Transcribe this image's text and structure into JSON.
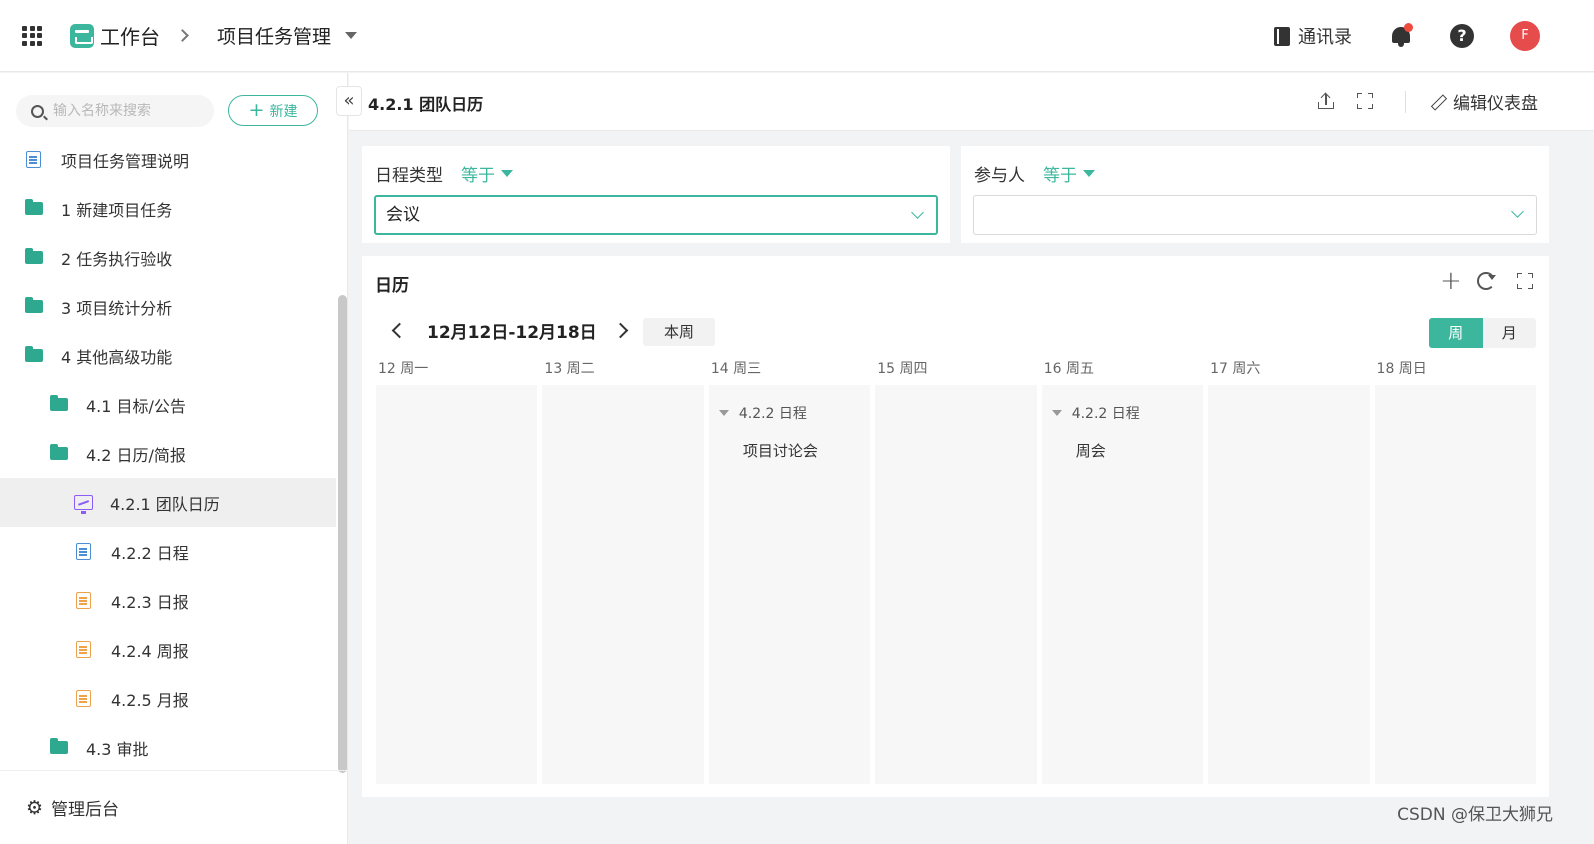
{
  "topbar": {
    "home": "工作台",
    "current": "项目任务管理",
    "contacts": "通讯录",
    "avatar_letter": "F",
    "icons": [
      "apps-grid-icon",
      "logo-icon",
      "chevron-right-icon",
      "caret-down-icon",
      "contacts-book-icon",
      "bell-icon",
      "help-icon"
    ]
  },
  "sidebar": {
    "search_placeholder": "输入名称来搜索",
    "new_label": "新建",
    "items": [
      {
        "label": "项目任务管理说明",
        "icon": "doc-icon"
      },
      {
        "label": "1 新建项目任务",
        "icon": "folder-icon"
      },
      {
        "label": "2 任务执行验收",
        "icon": "folder-icon"
      },
      {
        "label": "3 项目统计分析",
        "icon": "folder-icon"
      },
      {
        "label": "4 其他高级功能",
        "icon": "folder-icon"
      },
      {
        "label": "4.1 目标/公告",
        "icon": "folder-icon"
      },
      {
        "label": "4.2 日历/简报",
        "icon": "folder-icon"
      },
      {
        "label": "4.2.1 团队日历",
        "icon": "dashboard-icon",
        "active": true
      },
      {
        "label": "4.2.2 日程",
        "icon": "doc-icon"
      },
      {
        "label": "4.2.3 日报",
        "icon": "doc-icon-orange"
      },
      {
        "label": "4.2.4 周报",
        "icon": "doc-icon-orange"
      },
      {
        "label": "4.2.5 月报",
        "icon": "doc-icon-orange"
      },
      {
        "label": "4.3 审批",
        "icon": "folder-icon"
      }
    ],
    "admin_label": "管理后台",
    "collapse_glyph": "«"
  },
  "main": {
    "title": "4.2.1 团队日历",
    "edit_label": "编辑仪表盘"
  },
  "filters": [
    {
      "label": "日程类型",
      "operator": "等于",
      "value": "会议"
    },
    {
      "label": "参与人",
      "operator": "等于",
      "value": ""
    }
  ],
  "calendar": {
    "title": "日历",
    "range": "12月12日-12月18日",
    "today_label": "本周",
    "view_week": "周",
    "view_month": "月",
    "days": [
      {
        "label": "12 周一"
      },
      {
        "label": "13 周二"
      },
      {
        "label": "14 周三",
        "event": {
          "group": "4.2.2 日程",
          "title": "项目讨论会"
        }
      },
      {
        "label": "15 周四"
      },
      {
        "label": "16 周五",
        "event": {
          "group": "4.2.2 日程",
          "title": "周会"
        }
      },
      {
        "label": "17 周六"
      },
      {
        "label": "18 周日"
      }
    ]
  },
  "watermark": "CSDN @保卫大狮兄",
  "colors": {
    "accent": "#3cb79e",
    "badge": "#f04a3e",
    "avatar": "#e74c4c"
  }
}
